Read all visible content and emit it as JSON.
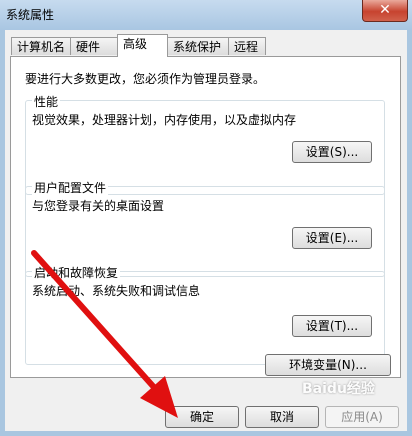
{
  "window": {
    "title": "系统属性",
    "close_glyph": "✕"
  },
  "tabs": [
    {
      "label": "计算机名"
    },
    {
      "label": "硬件"
    },
    {
      "label": "高级"
    },
    {
      "label": "系统保护"
    },
    {
      "label": "远程"
    }
  ],
  "active_tab": "高级",
  "advanced": {
    "intro": "要进行大多数更改，您必须作为管理员登录。",
    "performance": {
      "title": "性能",
      "desc": "视觉效果，处理器计划，内存使用，以及虚拟内存",
      "button": "设置(S)..."
    },
    "profile": {
      "title": "用户配置文件",
      "desc": "与您登录有关的桌面设置",
      "button": "设置(E)..."
    },
    "startup": {
      "title": "启动和故障恢复",
      "desc": "系统启动、系统失败和调试信息",
      "button": "设置(T)..."
    },
    "env_button": "环境变量(N)..."
  },
  "footer": {
    "ok": "确定",
    "cancel": "取消",
    "apply": "应用(A)"
  },
  "watermark": "Baidu经验",
  "annotation": {
    "arrow_color": "#e01010"
  }
}
